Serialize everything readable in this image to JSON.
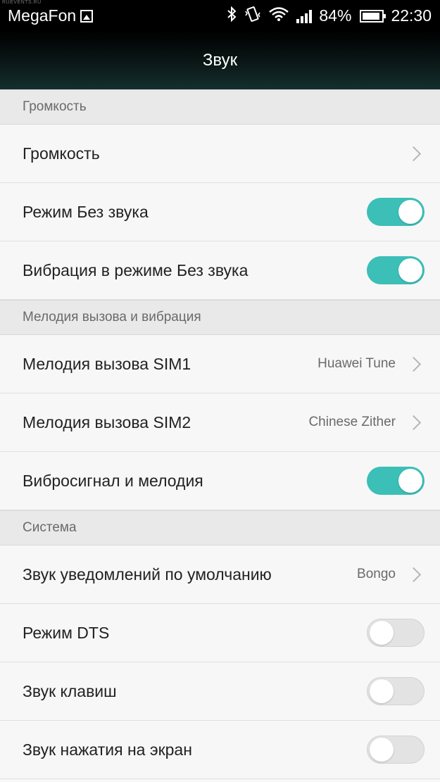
{
  "status_bar": {
    "carrier": "MegaFon",
    "battery": "84%",
    "time": "22:30",
    "watermark": "RUEVENTS.RU",
    "icons": [
      "image-icon",
      "bluetooth-icon",
      "vibrate-icon",
      "wifi-icon",
      "signal-icon",
      "battery-icon"
    ]
  },
  "header": {
    "title": "Звук"
  },
  "sections": {
    "volume": {
      "title": "Громкость",
      "items": [
        {
          "label": "Громкость"
        },
        {
          "label": "Режим Без звука",
          "checked": true
        },
        {
          "label": "Вибрация в режиме Без звука",
          "checked": true
        }
      ]
    },
    "ringtone": {
      "title": "Мелодия вызова и вибрация",
      "items": [
        {
          "label": "Мелодия вызова SIM1",
          "value": "Huawei Tune"
        },
        {
          "label": "Мелодия вызова SIM2",
          "value": "Chinese Zither"
        },
        {
          "label": "Вибросигнал и мелодия",
          "checked": true
        }
      ]
    },
    "system": {
      "title": "Система",
      "items": [
        {
          "label": "Звук уведомлений по умолчанию",
          "value": "Bongo"
        },
        {
          "label": "Режим DTS",
          "checked": false
        },
        {
          "label": "Звук клавиш",
          "checked": false
        },
        {
          "label": "Звук нажатия на экран",
          "checked": false
        }
      ]
    }
  },
  "colors": {
    "accent": "#3bbfb7",
    "toggle_off": "#e3e3e3"
  }
}
